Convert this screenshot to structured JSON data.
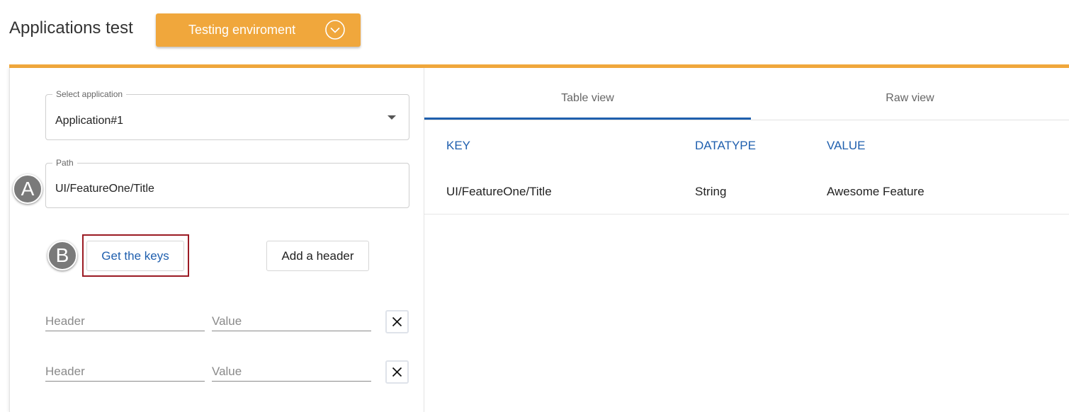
{
  "header": {
    "title": "Applications test",
    "environment_label": "Testing enviroment"
  },
  "form": {
    "application": {
      "label": "Select application",
      "value": "Application#1"
    },
    "path": {
      "label": "Path",
      "value": "UI/FeatureOne/Title"
    },
    "get_keys_label": "Get the keys",
    "add_header_label": "Add a header",
    "headers": [
      {
        "key_placeholder": "Header",
        "value_placeholder": "Value"
      },
      {
        "key_placeholder": "Header",
        "value_placeholder": "Value"
      }
    ]
  },
  "markers": {
    "a": "A",
    "b": "B"
  },
  "tabs": [
    {
      "label": "Table view",
      "active": true
    },
    {
      "label": "Raw view",
      "active": false
    }
  ],
  "table": {
    "columns": [
      "KEY",
      "DATATYPE",
      "VALUE"
    ],
    "rows": [
      {
        "key": "UI/FeatureOne/Title",
        "datatype": "String",
        "value": "Awesome Feature"
      }
    ]
  },
  "colors": {
    "accent": "#f0a73c",
    "link_blue": "#1f5fae",
    "highlight_border": "#9b1b24"
  },
  "icons": {
    "env_toggle": "chevron-down-circle-icon",
    "remove": "close-icon",
    "dropdown": "caret-down-icon"
  }
}
